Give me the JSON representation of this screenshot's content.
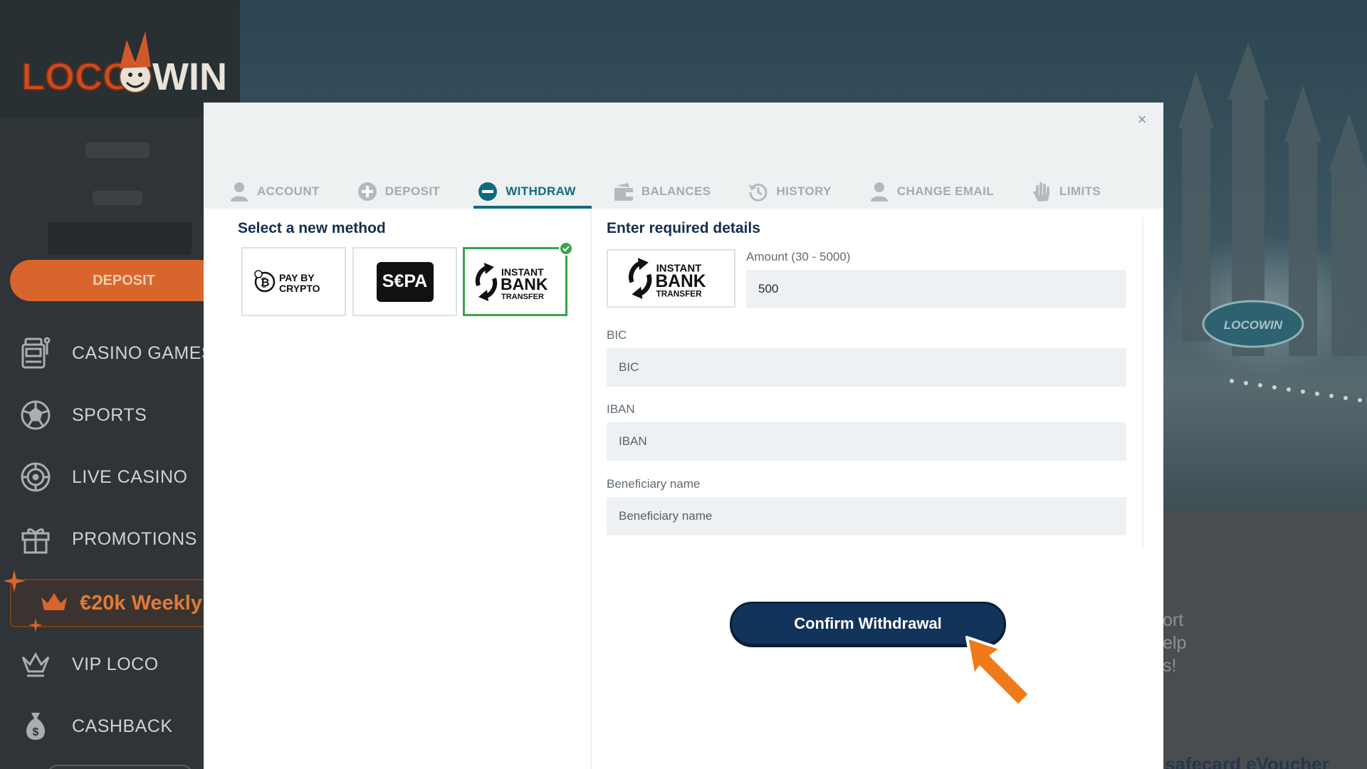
{
  "brand": {
    "logo_left": "LOCO",
    "logo_right": "WIN"
  },
  "sidebar": {
    "deposit_label": "DEPOSIT",
    "nav": [
      {
        "label": "CASINO GAMES",
        "icon": "slot-machine-icon"
      },
      {
        "label": "SPORTS",
        "icon": "soccer-ball-icon"
      },
      {
        "label": "LIVE CASINO",
        "icon": "roulette-wheel-icon"
      },
      {
        "label": "PROMOTIONS",
        "icon": "gift-icon"
      },
      {
        "label": "€20k Weekly",
        "icon": "crown-icon"
      },
      {
        "label": "VIP LOCO",
        "icon": "vip-crown-icon"
      },
      {
        "label": "CASHBACK",
        "icon": "money-bag-icon"
      }
    ]
  },
  "modal": {
    "close_label": "×",
    "tabs": [
      {
        "label": "ACCOUNT",
        "icon": "user-icon",
        "active": false
      },
      {
        "label": "DEPOSIT",
        "icon": "plus-circle-icon",
        "active": false
      },
      {
        "label": "WITHDRAW",
        "icon": "minus-circle-icon",
        "active": true
      },
      {
        "label": "BALANCES",
        "icon": "wallet-icon",
        "active": false
      },
      {
        "label": "HISTORY",
        "icon": "history-icon",
        "active": false
      },
      {
        "label": "CHANGE EMAIL",
        "icon": "user-icon",
        "active": false
      },
      {
        "label": "LIMITS",
        "icon": "hand-icon",
        "active": false
      }
    ],
    "left": {
      "title": "Select a new method",
      "methods": [
        {
          "name": "PAY BY CRYPTO",
          "line1": "PAY BY",
          "line2": "CRYPTO",
          "selected": false
        },
        {
          "name": "SEPA",
          "label": "S€PA",
          "selected": false
        },
        {
          "name": "INSTANT BANK TRANSFER",
          "line1": "INSTANT",
          "line2": "BANK",
          "line3": "TRANSFER",
          "selected": true
        }
      ]
    },
    "right": {
      "title": "Enter required details",
      "amount_label": "Amount (30 - 5000)",
      "amount_value": "500",
      "bic_label": "BIC",
      "bic_placeholder": "BIC",
      "iban_label": "IBAN",
      "iban_placeholder": "IBAN",
      "beneficiary_label": "Beneficiary name",
      "beneficiary_placeholder": "Beneficiary name"
    },
    "confirm_label": "Confirm Withdrawal"
  },
  "background": {
    "sign_text": "LOCOWIN",
    "peek_text": "ort\nelp\ns!",
    "peek_logos": "safecard  eVoucher"
  },
  "colors": {
    "accent": "#0f6a80",
    "primary_button": "#12335a",
    "deposit_orange": "#d9652c",
    "selected_green": "#38a34a",
    "cursor_orange": "#f07a1a"
  }
}
